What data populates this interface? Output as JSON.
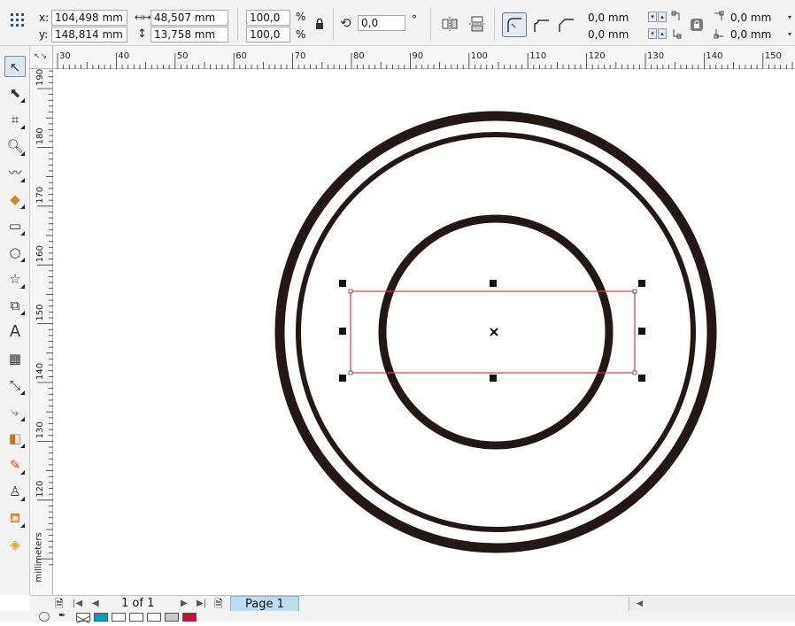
{
  "property_bar": {
    "x_label": "x:",
    "x_value": "104,498 mm",
    "y_label": "y:",
    "y_value": "148,814 mm",
    "width_value": "48,507 mm",
    "height_value": "13,758 mm",
    "scale_x": "100,0",
    "scale_y": "100,0",
    "percent_symbol": "%",
    "rotation_value": "0,0",
    "degree_symbol": "°",
    "corner_top_value": "0,0 mm",
    "corner_bottom_value": "0,0 mm",
    "corner_right_top_value": "0,0 mm",
    "corner_right_bottom_value": "0,0 mm"
  },
  "ruler": {
    "top_labels": [
      "30",
      "40",
      "50",
      "60",
      "70",
      "80",
      "90",
      "100",
      "110",
      "120",
      "130",
      "140",
      "150"
    ],
    "left_labels": [
      "190",
      "180",
      "170",
      "160",
      "150",
      "140",
      "130",
      "120"
    ],
    "unit_label": "millimeters"
  },
  "status_bar": {
    "page_count": "1 of 1",
    "page_tab": "Page 1"
  },
  "palette": {
    "colors": [
      "#00a0c6",
      "#ffffff",
      "#ffffff",
      "#ffffff",
      "#c7c7c7",
      "#c8102e"
    ]
  },
  "drawing": {
    "stroke_color": "#231815",
    "selection_color": "#e5334b"
  },
  "icons": {
    "toolbox": [
      "pick-tool-icon",
      "shape-tool-icon",
      "crop-tool-icon",
      "zoom-tool-icon",
      "freehand-tool-icon",
      "smart-fill-icon",
      "rectangle-tool-icon",
      "ellipse-tool-icon",
      "polygon-tool-icon",
      "basic-shapes-icon",
      "text-tool-icon",
      "table-tool-icon",
      "dimension-tool-icon",
      "connector-tool-icon",
      "blend-tool-icon",
      "color-eyedropper-icon",
      "outline-pen-icon",
      "fill-bucket-icon",
      "interactive-fill-icon"
    ]
  }
}
